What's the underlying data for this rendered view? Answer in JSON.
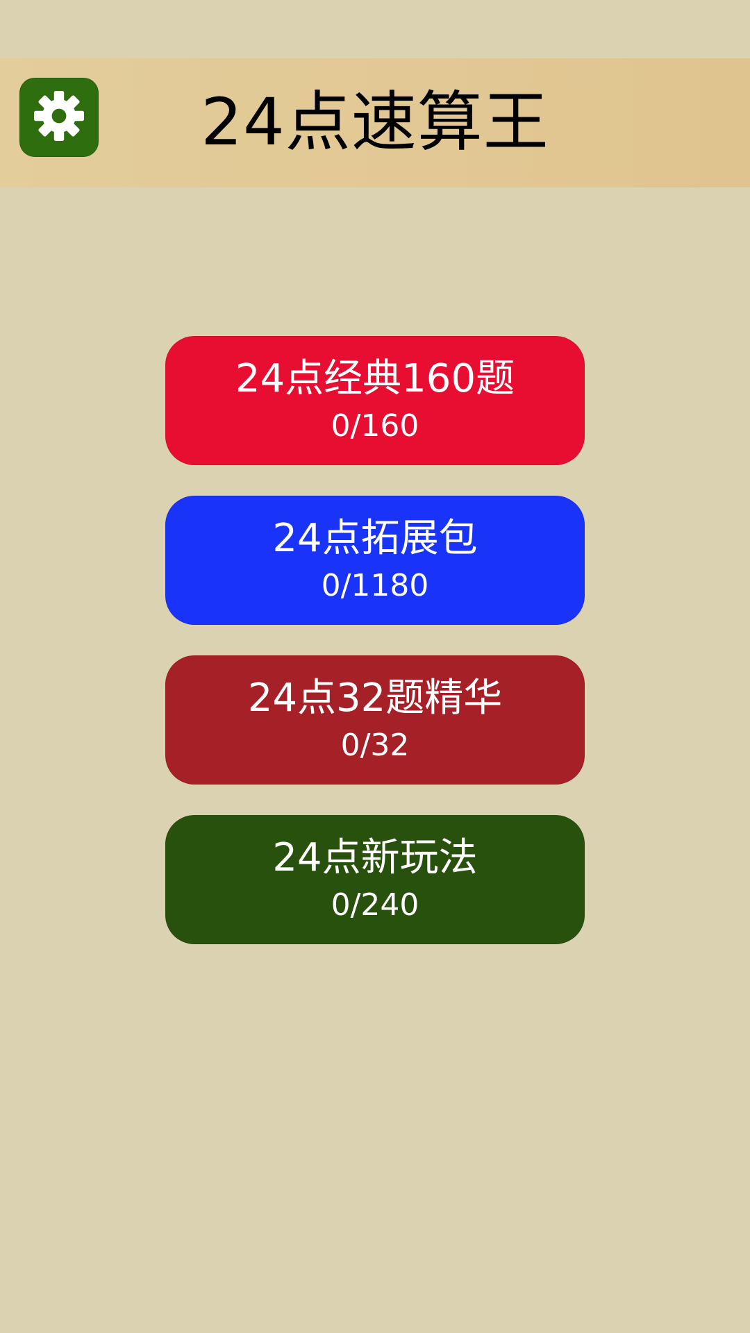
{
  "header": {
    "title": "24点速算王",
    "settings_icon": "gear-icon",
    "background": "#e2c894",
    "settings_color": "#2f6e0f"
  },
  "menu": {
    "items": [
      {
        "label": "24点经典160题",
        "progress": "0/160",
        "color": "#e80e31",
        "solved": 0,
        "total": 160
      },
      {
        "label": "24点拓展包",
        "progress": "0/1180",
        "color": "#1934f8",
        "solved": 0,
        "total": 1180
      },
      {
        "label": "24点32题精华",
        "progress": "0/32",
        "color": "#a52027",
        "solved": 0,
        "total": 32
      },
      {
        "label": "24点新玩法",
        "progress": "0/240",
        "color": "#29510e",
        "solved": 0,
        "total": 240
      }
    ]
  },
  "colors": {
    "page_background": "#dad2b1"
  }
}
